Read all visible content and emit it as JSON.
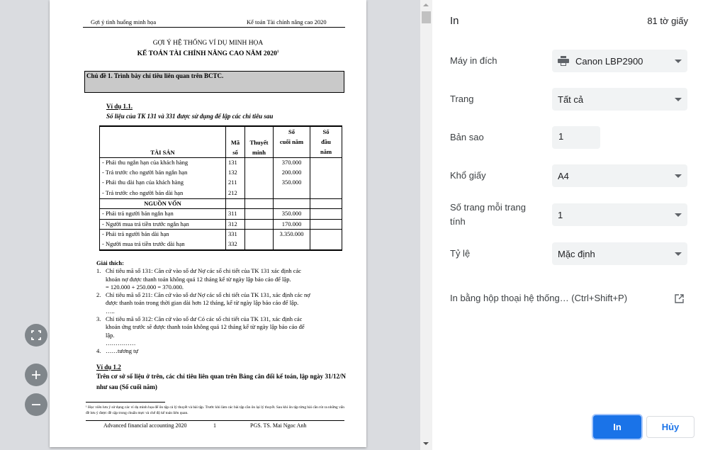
{
  "preview": {
    "document": {
      "header_left": "Gợi ý tình huống minh họa",
      "header_right": "Kế toán Tài chính nâng cao 2020",
      "title_line1": "GỢI Ý HỆ THỐNG VÍ DỤ MINH HỌA",
      "title_line2": "KẾ TOÁN TÀI CHÍNH NÂNG CAO NĂM 2020",
      "title_footnote_mark": "1",
      "topic": "Chủ đề 1. Trình bày chỉ tiêu liên quan trên BCTC.",
      "example1_title": "Ví dụ 1.1.",
      "example1_subtitle": "Số liệu của TK 131 và 331 được sử dụng để lập các chỉ tiêu sau",
      "table": {
        "headers": [
          "TÀI SẢN",
          "Mã số",
          "Thuyết minh",
          "Số cuối năm",
          "Số đầu năm"
        ],
        "header_lines": {
          "code": [
            "Mã",
            "số"
          ],
          "note": [
            "Thuyết",
            "minh"
          ],
          "end": [
            "Số",
            "cuối năm"
          ],
          "start": [
            "Số",
            "đầu",
            "năm"
          ]
        },
        "rows": [
          {
            "name": "- Phải thu ngắn hạn của khách hàng",
            "code": "131",
            "note": "",
            "end": "370.000",
            "start": ""
          },
          {
            "name": "- Trả trước cho người bán ngắn hạn",
            "code": "132",
            "note": "",
            "end": "200.000",
            "start": ""
          },
          {
            "name": "-  Phải thu dài hạn của khách hàng",
            "code": "211",
            "note": "",
            "end": "350.000",
            "start": ""
          },
          {
            "name": "- Trả trước cho người bán dài hạn",
            "code": "212",
            "note": "",
            "end": "",
            "start": ""
          },
          {
            "name": "NGUỒN VỐN",
            "code": "",
            "note": "",
            "end": "",
            "start": ""
          },
          {
            "name": "- Phải trả người bán ngắn hạn",
            "code": "311",
            "note": "",
            "end": "350.000",
            "start": ""
          },
          {
            "name": "- Người mua trả tiền trước ngắn hạn",
            "code": "312",
            "note": "",
            "end": "170.000",
            "start": ""
          },
          {
            "name": "- Phải trả người bán dài hạn",
            "code": "331",
            "note": "",
            "end": "3.350.000",
            "start": ""
          },
          {
            "name": "- Người mua trả tiền trước dài hạn",
            "code": "332",
            "note": "",
            "end": "",
            "start": ""
          }
        ]
      },
      "explanation_title": "Giải thích:",
      "explanations": [
        {
          "num": "1.",
          "lines": [
            "Chỉ tiêu mã số 131: Căn cứ vào số dư Nợ các sổ chi tiết của TK 131 xác định các",
            "khoản nợ được thanh toán không quá 12 tháng kể từ ngày lập báo cáo để lập.",
            "= 120.000 + 250.000 = 370.000."
          ]
        },
        {
          "num": "2.",
          "lines": [
            "Chỉ tiêu mã số 211: Căn cứ vào số dư Nợ các sổ chi tiết của TK 131, xác định các nợ",
            "được thanh toán trong thời gian dài hơn 12 tháng, kể từ ngày lập báo cáo để lập.",
            "….."
          ]
        },
        {
          "num": "3.",
          "lines": [
            "Chỉ tiêu mã số 312: Căn cứ vào số dư Có các sổ chi tiết của TK 131, xác định các",
            "khoản ứng trước sẽ được thanh toán không quá 12 tháng kể từ ngày lập báo cáo để",
            "lập.",
            "……………"
          ]
        },
        {
          "num": "4.",
          "lines": [
            "……tương tự"
          ]
        }
      ],
      "example2_title": "Ví dụ 1.2",
      "example2_body": "Trên cơ sở số liệu ở trên, các chỉ tiêu liên quan trên Bảng cân đối kế toán, lập ngày 31/12/N như sau (Số cuối năm)",
      "footnote": "¹ Học viên lưu ý sử dụng các ví dụ minh họa để ôn tập cả lý thuyết và bài tập. Trước khi làm các bài tập cần ôn lại lý thuyết. Sau khi ôn tập từng bài cần rút ra những vấn đề lưu ý được đề cập trong chuẩn mực và chế độ kế toán liên quan.",
      "footer_left": "Advanced financial accounting 2020",
      "footer_page": "1",
      "footer_right": "PGS. TS. Mai Ngoc Anh"
    },
    "zoom_controls": {
      "fit_icon": "fit-to-page-icon",
      "zoom_in_icon": "plus-icon",
      "zoom_out_icon": "minus-icon"
    }
  },
  "panel": {
    "title": "In",
    "sheet_count": "81 tờ giấy",
    "settings": [
      {
        "label": "Máy in đích",
        "value": "Canon LBP2900",
        "icon": "printer-icon",
        "type": "select"
      },
      {
        "label": "Trang",
        "value": "Tất cả",
        "type": "select"
      },
      {
        "label": "Bản sao",
        "value": "1",
        "type": "input"
      },
      {
        "label": "Khổ giấy",
        "value": "A4",
        "type": "select"
      },
      {
        "label": "Số trang mỗi trang tính",
        "label_lines": [
          "Số trang mỗi trang",
          "tính"
        ],
        "value": "1",
        "type": "select"
      },
      {
        "label": "Tỷ lệ",
        "value": "Mặc định",
        "type": "select"
      }
    ],
    "system_dialog_link": "In bằng hộp thoại hệ thống… (Ctrl+Shift+P)",
    "print_button": "In",
    "cancel_button": "Hủy",
    "accent_color": "#1a73e8"
  }
}
